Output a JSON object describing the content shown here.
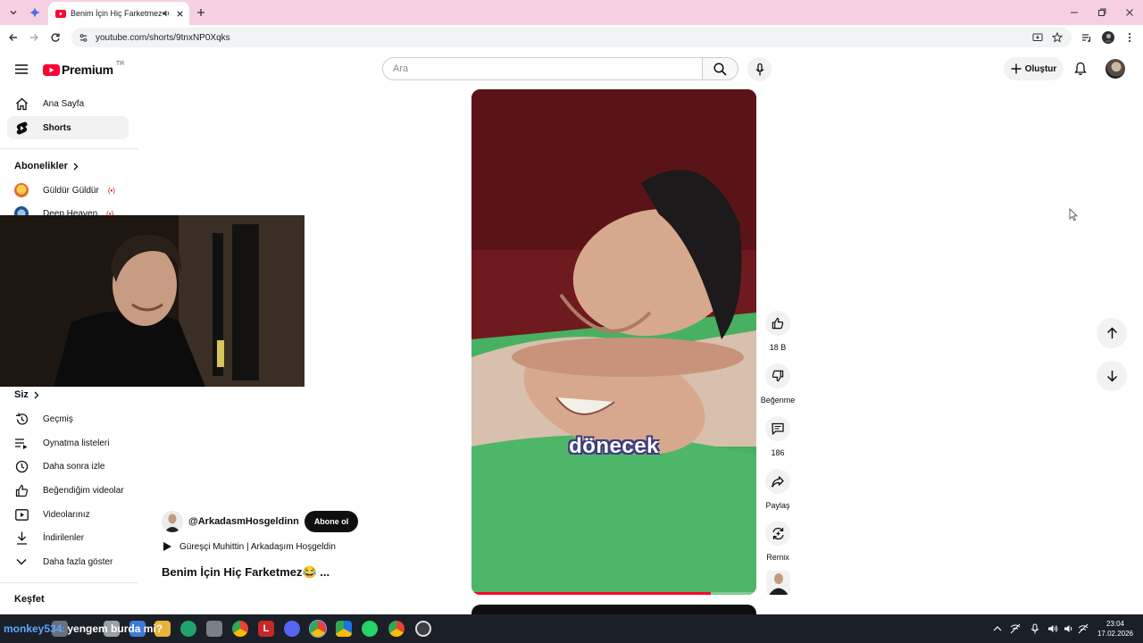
{
  "browser": {
    "tab_title": "Benim İçin Hiç Farketmez😂",
    "url": "youtube.com/shorts/9tnxNP0Xqks"
  },
  "header": {
    "logo_text": "Premium",
    "region": "TR",
    "search_placeholder": "Ara",
    "create_label": "Oluştur"
  },
  "sidebar": {
    "nav": [
      {
        "label": "Ana Sayfa",
        "icon": "home-icon"
      },
      {
        "label": "Shorts",
        "icon": "shorts-icon",
        "active": true
      }
    ],
    "subscriptions_heading": "Abonelikler",
    "subscriptions": [
      {
        "label": "Güldür Güldür",
        "live": "(•)"
      },
      {
        "label": "Deep Heaven",
        "live": "(•)"
      }
    ],
    "you_heading": "Siz",
    "you_items": [
      {
        "label": "Geçmiş",
        "icon": "history-icon"
      },
      {
        "label": "Oynatma listeleri",
        "icon": "playlist-icon"
      },
      {
        "label": "Daha sonra izle",
        "icon": "clock-icon"
      },
      {
        "label": "Beğendiğim videolar",
        "icon": "thumb-up-icon"
      },
      {
        "label": "Videolarınız",
        "icon": "video-icon"
      },
      {
        "label": "İndirilenler",
        "icon": "download-icon"
      },
      {
        "label": "Daha fazla göster",
        "icon": "chevron-down-icon"
      }
    ],
    "explore_heading": "Keşfet"
  },
  "short": {
    "caption": "dönecek",
    "progress": 0.84,
    "channel": "@ArkadasmHosgeldinn",
    "subscribe_label": "Abone ol",
    "sound": "Güreşçi Muhittin | Arkadaşım Hoşgeldin",
    "title": "Benim İçin Hiç Farketmez😂 ..."
  },
  "actions": {
    "likes": "18 B",
    "dislike": "Beğenme",
    "comments": "186",
    "share": "Paylaş",
    "remix": "Remix"
  },
  "taskbar": {
    "ticker_user": "monkey534:",
    "ticker_text": "yengem burda mi?",
    "time": "23:04",
    "date": "17.02.2026"
  },
  "colors": {
    "tab_strip": "#f7cfe3",
    "brand_red": "#ff0033",
    "caption_outline": "#3c3d7c",
    "taskbar": "#1b1f27"
  }
}
